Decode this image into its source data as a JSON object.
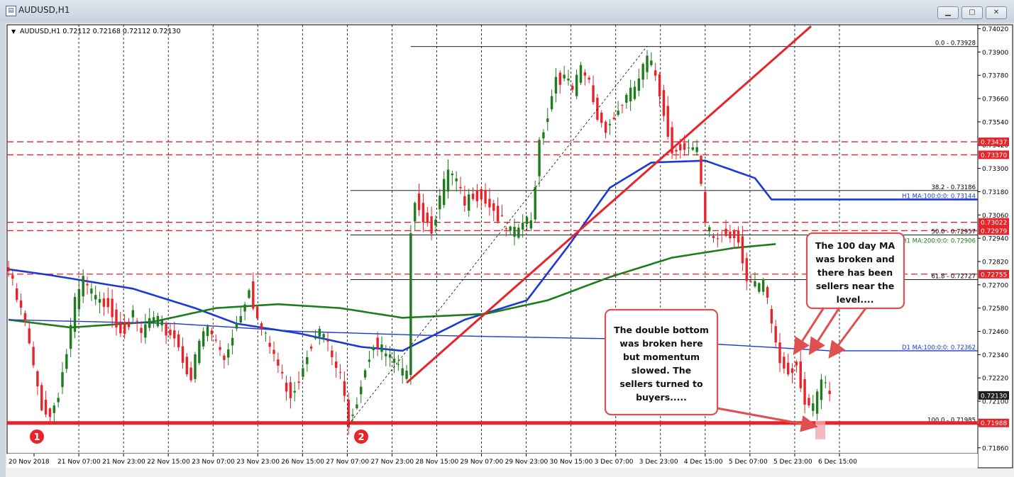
{
  "window": {
    "title": "AUDUSD,H1",
    "icon": "chart-icon",
    "btn_min": "▁",
    "btn_max": "▢",
    "btn_close": "✕"
  },
  "header_text": "AUDUSD,H1  0.72112 0.72168 0.72112 0.72130",
  "header_arrow": "▼",
  "chart_data": {
    "type": "candlestick",
    "symbol": "AUDUSD",
    "timeframe": "H1",
    "ohlc_header": {
      "open": 0.72112,
      "high": 0.72168,
      "low": 0.72112,
      "close": 0.7213
    },
    "y_ticks": [
      "0.74020",
      "0.73900",
      "0.73780",
      "0.73660",
      "0.73540",
      "0.73420",
      "0.73300",
      "0.73180",
      "0.73060",
      "0.72940",
      "0.72820",
      "0.72700",
      "0.72580",
      "0.72460",
      "0.72340",
      "0.72220",
      "0.72100",
      "0.71980",
      "0.71860"
    ],
    "x_ticks": [
      "20 Nov 2018",
      "21 Nov 07:00",
      "21 Nov 23:00",
      "22 Nov 15:00",
      "23 Nov 07:00",
      "23 Nov 23:00",
      "26 Nov 15:00",
      "27 Nov 07:00",
      "27 Nov 23:00",
      "28 Nov 15:00",
      "29 Nov 07:00",
      "29 Nov 23:00",
      "30 Nov 15:00",
      "3 Dec 07:00",
      "3 Dec 23:00",
      "4 Dec 15:00",
      "5 Dec 07:00",
      "5 Dec 23:00",
      "6 Dec 15:00"
    ],
    "ylim": [
      0.7183,
      0.7404
    ],
    "price_path": [
      [
        0,
        0.7277
      ],
      [
        2,
        0.7262
      ],
      [
        4,
        0.725
      ],
      [
        6,
        0.7226
      ],
      [
        8,
        0.7208
      ],
      [
        10,
        0.7202
      ],
      [
        12,
        0.7215
      ],
      [
        14,
        0.7235
      ],
      [
        16,
        0.726
      ],
      [
        18,
        0.7272
      ],
      [
        20,
        0.7265
      ],
      [
        22,
        0.726
      ],
      [
        24,
        0.7262
      ],
      [
        26,
        0.725
      ],
      [
        28,
        0.7248
      ],
      [
        30,
        0.7253
      ],
      [
        32,
        0.7244
      ],
      [
        34,
        0.7252
      ],
      [
        36,
        0.725
      ],
      [
        38,
        0.7246
      ],
      [
        40,
        0.7244
      ],
      [
        42,
        0.7232
      ],
      [
        44,
        0.7222
      ],
      [
        46,
        0.724
      ],
      [
        48,
        0.7248
      ],
      [
        50,
        0.724
      ],
      [
        52,
        0.7232
      ],
      [
        54,
        0.7245
      ],
      [
        56,
        0.7256
      ],
      [
        58,
        0.727
      ],
      [
        60,
        0.7252
      ],
      [
        62,
        0.7242
      ],
      [
        64,
        0.7234
      ],
      [
        66,
        0.7222
      ],
      [
        68,
        0.7214
      ],
      [
        70,
        0.7222
      ],
      [
        72,
        0.7236
      ],
      [
        74,
        0.7246
      ],
      [
        76,
        0.7244
      ],
      [
        78,
        0.7232
      ],
      [
        80,
        0.7222
      ],
      [
        82,
        0.72
      ],
      [
        84,
        0.7212
      ],
      [
        86,
        0.7228
      ],
      [
        88,
        0.724
      ],
      [
        90,
        0.7236
      ],
      [
        92,
        0.7232
      ],
      [
        94,
        0.7226
      ],
      [
        96,
        0.7222
      ],
      [
        97,
        0.73
      ],
      [
        98,
        0.7316
      ],
      [
        100,
        0.7305
      ],
      [
        102,
        0.73
      ],
      [
        104,
        0.7314
      ],
      [
        106,
        0.7328
      ],
      [
        108,
        0.7322
      ],
      [
        110,
        0.731
      ],
      [
        112,
        0.7318
      ],
      [
        114,
        0.7316
      ],
      [
        116,
        0.7312
      ],
      [
        118,
        0.7305
      ],
      [
        120,
        0.7298
      ],
      [
        122,
        0.7296
      ],
      [
        124,
        0.7302
      ],
      [
        126,
        0.7302
      ],
      [
        128,
        0.7345
      ],
      [
        130,
        0.7358
      ],
      [
        132,
        0.7378
      ],
      [
        134,
        0.7376
      ],
      [
        136,
        0.737
      ],
      [
        138,
        0.738
      ],
      [
        140,
        0.7374
      ],
      [
        142,
        0.7356
      ],
      [
        144,
        0.7352
      ],
      [
        146,
        0.7356
      ],
      [
        148,
        0.7364
      ],
      [
        150,
        0.7368
      ],
      [
        152,
        0.7376
      ],
      [
        154,
        0.7386
      ],
      [
        156,
        0.7378
      ],
      [
        158,
        0.736
      ],
      [
        160,
        0.7338
      ],
      [
        162,
        0.7343
      ],
      [
        164,
        0.734
      ],
      [
        166,
        0.7338
      ],
      [
        168,
        0.73
      ],
      [
        170,
        0.7294
      ],
      [
        172,
        0.7296
      ],
      [
        174,
        0.7296
      ],
      [
        176,
        0.7295
      ],
      [
        178,
        0.7272
      ],
      [
        180,
        0.7268
      ],
      [
        182,
        0.727
      ],
      [
        184,
        0.725
      ],
      [
        186,
        0.723
      ],
      [
        188,
        0.7226
      ],
      [
        190,
        0.723
      ],
      [
        192,
        0.721
      ],
      [
        194,
        0.7205
      ],
      [
        196,
        0.722
      ],
      [
        198,
        0.7213
      ]
    ],
    "moving_averages": [
      {
        "name": "H1 MA:100:0:0: 0.73144",
        "color": "#1c39d6",
        "values": [
          [
            0,
            0.7278
          ],
          [
            10,
            0.7275
          ],
          [
            30,
            0.7268
          ],
          [
            45,
            0.7258
          ],
          [
            55,
            0.725
          ],
          [
            70,
            0.7245
          ],
          [
            85,
            0.7238
          ],
          [
            95,
            0.7236
          ],
          [
            110,
            0.7252
          ],
          [
            125,
            0.7262
          ],
          [
            135,
            0.729
          ],
          [
            145,
            0.732
          ],
          [
            155,
            0.7333
          ],
          [
            168,
            0.7334
          ],
          [
            172,
            0.7331
          ],
          [
            180,
            0.7325
          ],
          [
            184,
            0.7314
          ],
          [
            198,
            0.7314
          ]
        ]
      },
      {
        "name": "H1 MA:200:0:0: 0.72906",
        "color": "#1d7d1d",
        "values": [
          [
            0,
            0.7252
          ],
          [
            15,
            0.7248
          ],
          [
            35,
            0.7251
          ],
          [
            50,
            0.7258
          ],
          [
            65,
            0.726
          ],
          [
            80,
            0.7258
          ],
          [
            95,
            0.7253
          ],
          [
            115,
            0.7255
          ],
          [
            130,
            0.7262
          ],
          [
            145,
            0.7274
          ],
          [
            160,
            0.7284
          ],
          [
            175,
            0.7289
          ],
          [
            185,
            0.7291
          ]
        ]
      },
      {
        "name": "D1 MA:100:0:0: 0.72362",
        "color": "#1c39d6",
        "values": [
          [
            0,
            0.7252
          ],
          [
            40,
            0.725
          ],
          [
            70,
            0.7246
          ],
          [
            100,
            0.7244
          ],
          [
            150,
            0.7242
          ],
          [
            198,
            0.7236
          ]
        ]
      }
    ],
    "fibonacci": {
      "levels": [
        {
          "label": "0.0 - 0.73928",
          "value": 0.73928
        },
        {
          "label": "38.2 - 0.73186",
          "value": 0.73186
        },
        {
          "label": "50.0 - 0.72957",
          "value": 0.72957
        },
        {
          "label": "61.8 - 0.72727",
          "value": 0.72727
        },
        {
          "label": "100.0 - 0.71985",
          "value": 0.71985
        }
      ]
    },
    "red_levels": [
      0.73437,
      0.7337,
      0.73022,
      0.72979,
      0.72755
    ],
    "price_tags": [
      {
        "text": "0.73437",
        "value": 0.73437,
        "color": "#e8232a"
      },
      {
        "text": "0.73370",
        "value": 0.7337,
        "color": "#e8232a"
      },
      {
        "text": "0.73022",
        "value": 0.73022,
        "color": "#e8232a"
      },
      {
        "text": "0.72979",
        "value": 0.72979,
        "color": "#e8232a"
      },
      {
        "text": "0.72755",
        "value": 0.72755,
        "color": "#e8232a"
      },
      {
        "text": "0.72130",
        "value": 0.7213,
        "color": "#1e1e1e"
      },
      {
        "text": "0.71988",
        "value": 0.71988,
        "color": "#e8232a"
      }
    ],
    "support_line": 0.71988,
    "markers": [
      {
        "label": "1"
      },
      {
        "label": "2"
      }
    ],
    "annotations": [
      {
        "name": "double-bottom-note",
        "lines": [
          "The double bottom",
          "was broken here",
          "but momentum",
          "slowed. The",
          "sellers turned to",
          "buyers....."
        ]
      },
      {
        "name": "ma-broken-note",
        "lines": [
          "The 100 day MA",
          "was broken and",
          "there has been",
          "sellers near the",
          "level...."
        ]
      }
    ],
    "colors": {
      "background": "#ffffff",
      "up_candle": "#1d7d1d",
      "down_candle": "#e8232a",
      "trendline": "#e8232a",
      "annotation_border": "#e05050",
      "grid": "#000000"
    }
  }
}
